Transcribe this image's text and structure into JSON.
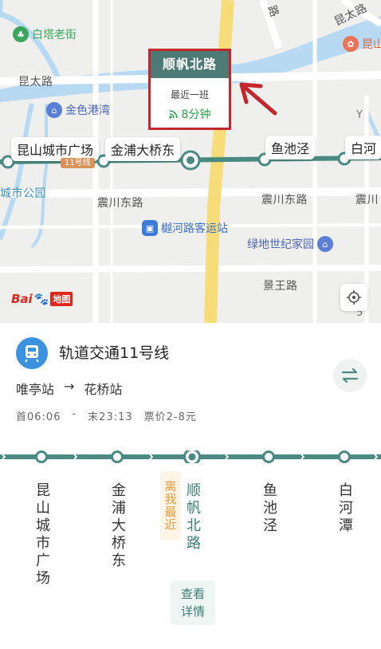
{
  "map": {
    "popup": {
      "station": "顺帆北路",
      "next_label": "最近一班",
      "eta": "8分钟"
    },
    "station_chips": [
      "昆山城市广场",
      "金浦大桥东",
      "鱼池泾",
      "白河"
    ],
    "line_tag": "11号线",
    "roads": [
      "昆太路",
      "昆太路",
      "震川东路",
      "震川东路",
      "震川",
      "景王路",
      "路"
    ],
    "areas": [
      "城市公园"
    ],
    "pois": [
      {
        "name": "白塔老街",
        "color": "#3aa55d",
        "icon": "park-icon"
      },
      {
        "name": "金色港湾",
        "color": "#5b7fd6",
        "icon": "residence-icon"
      },
      {
        "name": "樾河路客运站",
        "color": "#3d7bd9",
        "icon": "bus-icon"
      },
      {
        "name": "绿地世纪家园",
        "color": "#5b7fd6",
        "icon": "residence-icon"
      },
      {
        "name": "昆山",
        "color": "#e8745a",
        "icon": "food-icon"
      }
    ],
    "logo_text": "Bai",
    "logo_suffix": "地图"
  },
  "panel": {
    "line_name": "轨道交通11号线",
    "from": "唯亭站",
    "arrow": "→",
    "to": "花桥站",
    "first": "首06:06",
    "sep": "-",
    "last": "末23:13",
    "fare": "票价2-8元",
    "near_badge": "离我最近",
    "detail_button": "查看详情",
    "stations": [
      "昆山城市广场",
      "金浦大桥东",
      "顺帆北路",
      "鱼池泾",
      "白河潭"
    ],
    "current_index": 2,
    "colors": {
      "line": "#4a8a82",
      "accent": "#c1272d",
      "bus_blue": "#3d92e0"
    }
  }
}
